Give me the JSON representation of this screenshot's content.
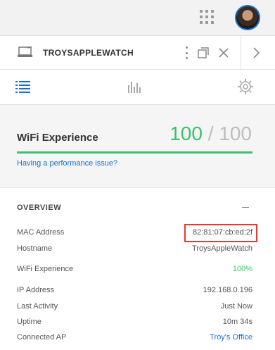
{
  "topbar": {
    "apps_icon": "apps-grid-icon",
    "avatar": "user-avatar"
  },
  "device": {
    "name": "TROYSAPPLEWATCH",
    "icon": "laptop-wifi-icon"
  },
  "tabs": [
    {
      "name": "overview-list",
      "icon": "list-icon"
    },
    {
      "name": "statistics",
      "icon": "bar-chart-icon"
    },
    {
      "name": "settings",
      "icon": "gear-icon"
    }
  ],
  "wifi": {
    "title": "WiFi Experience",
    "score": "100",
    "max": "100",
    "separator": " / ",
    "link": "Having a performance issue?"
  },
  "overview": {
    "title": "OVERVIEW",
    "rows": [
      {
        "label": "MAC Address",
        "value": "82:81:07:cb:ed:2f"
      },
      {
        "label": "Hostname",
        "value": "TroysAppleWatch"
      },
      {
        "label": "WiFi Experience",
        "value": "100%"
      },
      {
        "label": "IP Address",
        "value": "192.168.0.196"
      },
      {
        "label": "Last Activity",
        "value": "Just Now"
      },
      {
        "label": "Uptime",
        "value": "10m 34s"
      },
      {
        "label": "Connected AP",
        "value": "Troy's Office"
      }
    ]
  },
  "colors": {
    "accent": "#1a6fd1",
    "success": "#3cc26b",
    "highlight": "#e53935"
  }
}
